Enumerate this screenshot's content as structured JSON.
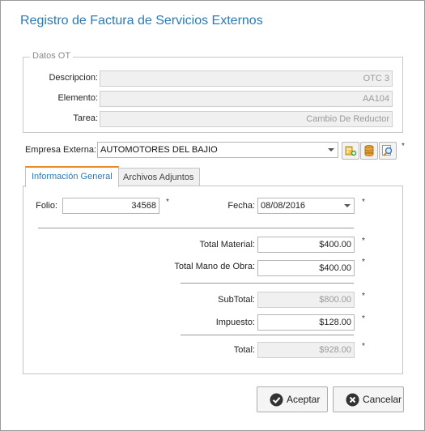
{
  "window": {
    "title": "Registro de Factura de Servicios Externos"
  },
  "datos_ot": {
    "legend": "Datos OT",
    "descripcion": {
      "label": "Descripcion:",
      "value": "OTC 3"
    },
    "elemento": {
      "label": "Elemento:",
      "value": "AA104"
    },
    "tarea": {
      "label": "Tarea:",
      "value": "Cambio De Reductor"
    }
  },
  "empresa": {
    "label": "Empresa Externa:",
    "value": "AUTOMOTORES DEL BAJIO",
    "required": "*",
    "icons": [
      "add-company-icon",
      "database-icon",
      "search-icon"
    ]
  },
  "tabs": [
    {
      "label": "Información General",
      "active": true
    },
    {
      "label": "Archivos Adjuntos",
      "active": false
    }
  ],
  "general": {
    "folio": {
      "label": "Folio:",
      "value": "34568",
      "required": "*"
    },
    "fecha": {
      "label": "Fecha:",
      "value": "08/08/2016",
      "required": "*"
    },
    "total_material": {
      "label": "Total Material:",
      "value": "$400.00",
      "required": "*"
    },
    "total_mano_obra": {
      "label": "Total Mano de Obra:",
      "value": "$400.00",
      "required": "*"
    },
    "subtotal": {
      "label": "SubTotal:",
      "value": "$800.00",
      "required": "*"
    },
    "impuesto": {
      "label": "Impuesto:",
      "value": "$128.00",
      "required": "*"
    },
    "total": {
      "label": "Total:",
      "value": "$928.00",
      "required": "*"
    }
  },
  "buttons": {
    "aceptar": "Aceptar",
    "cancelar": "Cancelar"
  },
  "colors": {
    "accent": "#2a7ab8",
    "tab_highlight": "#e88a2a"
  }
}
